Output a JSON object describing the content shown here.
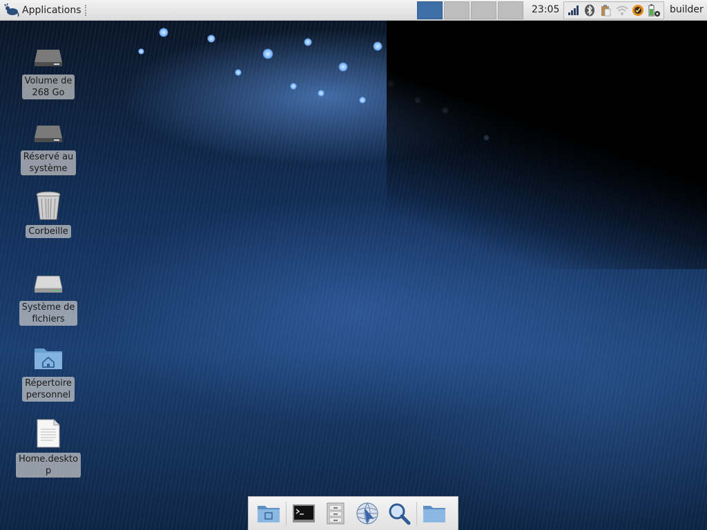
{
  "panel": {
    "app_menu_label": "Applications",
    "clock": "23:05",
    "user": "builder",
    "workspaces": [
      {
        "name": "workspace-1",
        "active": true
      },
      {
        "name": "workspace-2",
        "active": false
      },
      {
        "name": "workspace-3",
        "active": false
      },
      {
        "name": "workspace-4",
        "active": false
      }
    ],
    "tray_icons": [
      "network-signal-icon",
      "bluetooth-icon",
      "clipboard-icon",
      "wifi-icon",
      "update-notifier-icon",
      "battery-icon"
    ]
  },
  "desktop": {
    "icons": [
      {
        "name": "volume-268",
        "label": "Volume de\n268 Go",
        "icon": "hard-drive-icon"
      },
      {
        "name": "reserved-system",
        "label": "Réservé au\nsystème",
        "icon": "hard-drive-icon"
      },
      {
        "name": "trash",
        "label": "Corbeille",
        "icon": "trash-icon"
      },
      {
        "name": "filesystem",
        "label": "Système de\nfichiers",
        "icon": "hard-drive-icon"
      },
      {
        "name": "home-folder",
        "label": "Répertoire\npersonnel",
        "icon": "home-folder-icon"
      },
      {
        "name": "home-desktop-file",
        "label": "Home.deskto\np",
        "icon": "text-file-icon"
      }
    ]
  },
  "dock": {
    "items": [
      "file-manager-icon",
      "terminal-icon",
      "file-cabinet-icon",
      "web-browser-icon",
      "search-icon",
      "folder-icon"
    ]
  },
  "colors": {
    "workspace_active": "#3d6ea6",
    "panel_bg": "#e6e6e6"
  }
}
